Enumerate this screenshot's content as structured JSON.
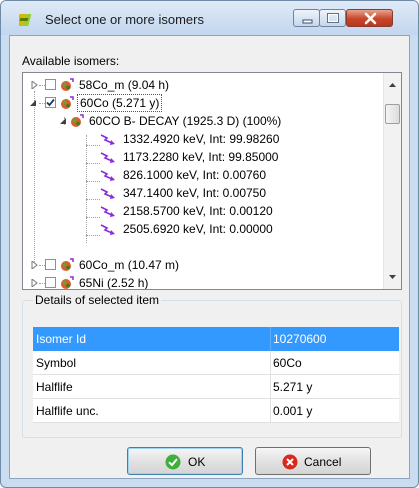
{
  "window": {
    "title": "Select one or more isomers",
    "app_icon": "isotope-app-icon",
    "controls": [
      "minimize",
      "maximize",
      "close"
    ]
  },
  "available_label": "Available isomers:",
  "tree": {
    "items": [
      {
        "label": "58Co_m (9.04 h)",
        "checked": false,
        "expanded": false
      },
      {
        "label": "60Co (5.271 y)",
        "checked": true,
        "expanded": true,
        "selected": true,
        "children": [
          {
            "label": "60CO B- DECAY (1925.3 D) (100%)",
            "expanded": true,
            "lines": [
              "1332.4920 keV, Int: 99.98260",
              "1173.2280 keV, Int: 99.85000",
              "826.1000 keV, Int: 0.00760",
              "347.1400 keV, Int: 0.00750",
              "2158.5700 keV, Int: 0.00120",
              "2505.6920 keV, Int: 0.00000"
            ]
          }
        ]
      },
      {
        "label": "60Co_m (10.47 m)",
        "checked": false,
        "expanded": false
      },
      {
        "label": "65Ni (2.52 h)",
        "checked": false,
        "expanded": false
      }
    ]
  },
  "details": {
    "legend": "Details of selected item",
    "rows": [
      {
        "key": "Isomer Id",
        "value": "10270600",
        "selected": true
      },
      {
        "key": "Symbol",
        "value": "60Co"
      },
      {
        "key": "Halflife",
        "value": "5.271 y"
      },
      {
        "key": "Halflife unc.",
        "value": "0.001 y"
      }
    ]
  },
  "buttons": {
    "ok": "OK",
    "cancel": "Cancel"
  },
  "colors": {
    "selection": "#3399ff",
    "ray": "#8a2be2",
    "ok_icon": "#3fae3a",
    "cancel_icon": "#d9291c"
  }
}
